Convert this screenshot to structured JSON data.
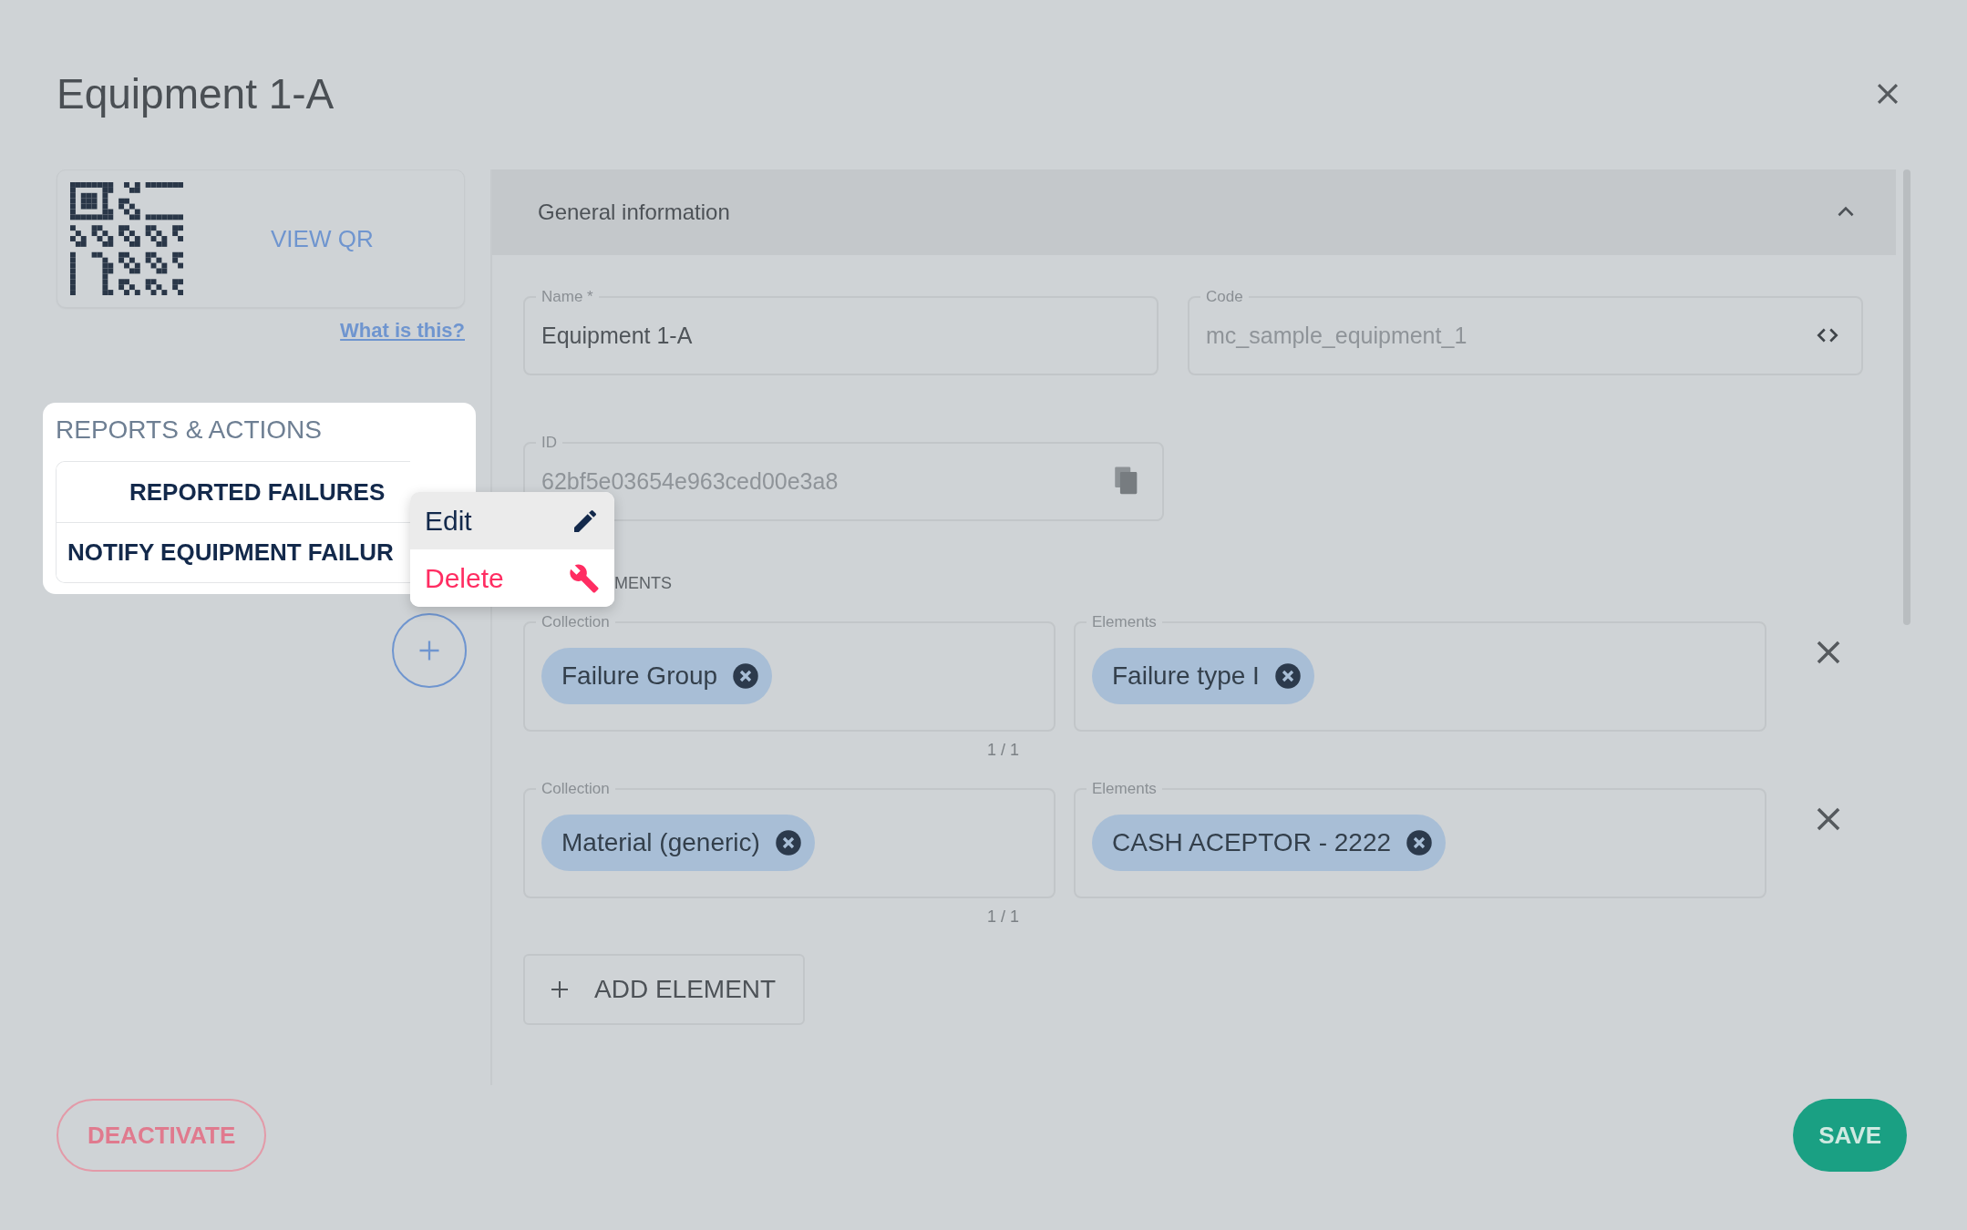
{
  "dialog": {
    "title": "Equipment 1-A"
  },
  "qr": {
    "view_button": "VIEW QR",
    "help_link": "What is this?"
  },
  "reports_actions": {
    "title": "REPORTS & ACTIONS",
    "items": [
      {
        "label": "REPORTED FAILURES"
      },
      {
        "label": "NOTIFY EQUIPMENT FAILUR"
      }
    ]
  },
  "context_menu": {
    "items": [
      {
        "label": "Edit",
        "kind": "edit",
        "selected": true
      },
      {
        "label": "Delete",
        "kind": "delete",
        "selected": false
      }
    ]
  },
  "general_information": {
    "title": "General information",
    "expanded": true,
    "fields": [
      {
        "label": "Name *",
        "value": "Equipment 1-A",
        "kind": "text",
        "disabled": false
      },
      {
        "label": "Code",
        "value": "mc_sample_equipment_1",
        "kind": "code",
        "disabled": true
      },
      {
        "label": "ID",
        "value": "62bf5e03654e963ced00e3a8",
        "kind": "copy",
        "disabled": true
      }
    ]
  },
  "elements": {
    "label": "MENTS",
    "rows": [
      {
        "collection_label": "Collection",
        "collection": "Failure Group",
        "elements_label": "Elements",
        "element": "Failure type I",
        "counter": "1 / 1"
      },
      {
        "collection_label": "Collection",
        "collection": "Material (generic)",
        "elements_label": "Elements",
        "element": "CASH ACEPTOR - 2222",
        "counter": "1 / 1"
      }
    ],
    "add_button": "ADD ELEMENT"
  },
  "footer": {
    "deactivate": "DEACTIVATE",
    "save": "SAVE"
  }
}
